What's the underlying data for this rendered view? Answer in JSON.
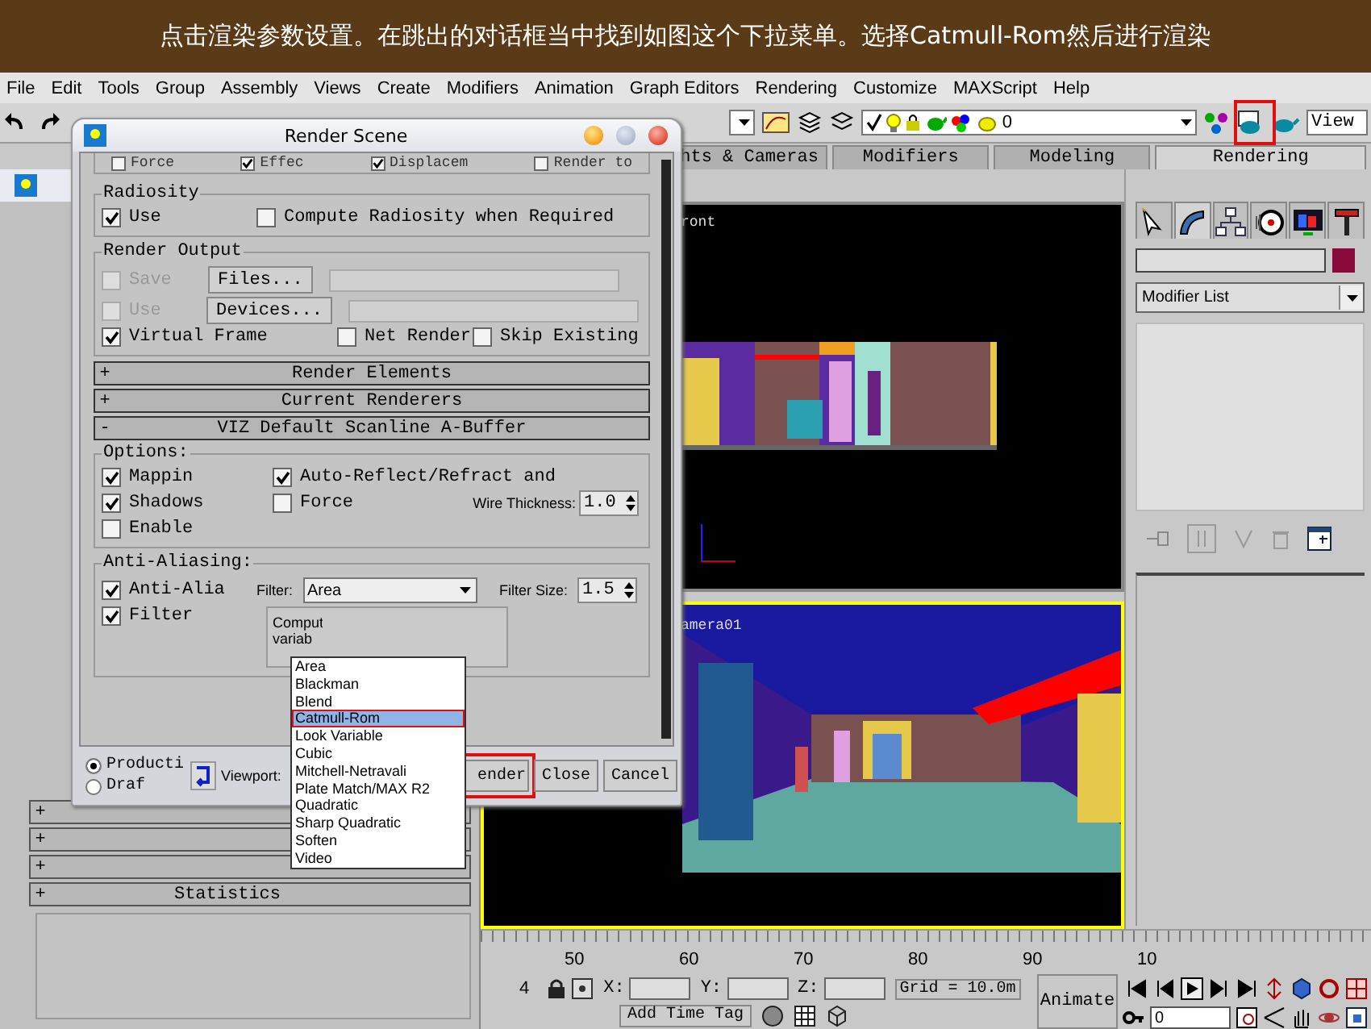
{
  "banner": {
    "text": "点击渲染参数设置。在跳出的对话框当中找到如图这个下拉菜单。选择Catmull-Rom然后进行渲染"
  },
  "menu": [
    "File",
    "Edit",
    "Tools",
    "Group",
    "Assembly",
    "Views",
    "Create",
    "Modifiers",
    "Animation",
    "Graph Editors",
    "Rendering",
    "Customize",
    "MAXScript",
    "Help"
  ],
  "toolbar": {
    "layer_value": "0",
    "view_field": "View"
  },
  "command_tabs": [
    {
      "label": "hts & Cameras",
      "selected": false
    },
    {
      "label": "Modifiers",
      "selected": false
    },
    {
      "label": "Modeling",
      "selected": false
    },
    {
      "label": "Rendering",
      "selected": true
    }
  ],
  "back_window": {
    "rollouts": [
      {
        "sign": "+"
      },
      {
        "sign": "+"
      },
      {
        "sign": "+"
      },
      {
        "sign": "+",
        "label": "Statistics"
      }
    ]
  },
  "viewports": [
    {
      "label": "ront",
      "active": false,
      "kind": "front"
    },
    {
      "label": "amera01",
      "active": true,
      "kind": "camera"
    }
  ],
  "command_panel": {
    "color": "#8b0a3c",
    "modifier_list": "Modifier List"
  },
  "timeline": {
    "ticks": [
      "50",
      "60",
      "70",
      "80",
      "90",
      "10"
    ]
  },
  "status": {
    "frame": "4",
    "x_label": "X:",
    "y_label": "Y:",
    "z_label": "Z:",
    "grid": "Grid = 10.0m",
    "add_time_tag": "Add Time Tag",
    "animate": "Animate",
    "frame_field": "0"
  },
  "dialog": {
    "title": "Render Scene",
    "top_row": [
      {
        "label": "Force",
        "checked": false,
        "disabled": false
      },
      {
        "label": "Effec",
        "checked": true,
        "disabled": false
      },
      {
        "label": "Displacem",
        "checked": true,
        "disabled": false
      },
      {
        "label": "Render to",
        "checked": false,
        "disabled": false
      }
    ],
    "radiosity": {
      "title": "Radiosity",
      "items": [
        {
          "label": "Use",
          "checked": true,
          "disabled": false
        },
        {
          "label": "Compute Radiosity when Required",
          "checked": false,
          "disabled": false
        }
      ]
    },
    "render_output": {
      "title": "Render Output",
      "rows": [
        {
          "label": "Save",
          "checked": false,
          "disabled": true,
          "button": "Files..."
        },
        {
          "label": "Use",
          "checked": false,
          "disabled": true,
          "button": "Devices..."
        }
      ],
      "flags": [
        {
          "label": "Virtual Frame",
          "checked": true,
          "disabled": false
        },
        {
          "label": "Net Render",
          "checked": false,
          "disabled": false
        },
        {
          "label": "Skip Existing",
          "checked": false,
          "disabled": false
        }
      ]
    },
    "rollouts": [
      {
        "sign": "+",
        "label": "Render Elements"
      },
      {
        "sign": "+",
        "label": "Current Renderers"
      },
      {
        "sign": "-",
        "label": "VIZ Default Scanline A-Buffer"
      }
    ],
    "options": {
      "title": "Options:",
      "items": [
        {
          "label": "Mappin",
          "checked": true,
          "disabled": false
        },
        {
          "label": "Auto-Reflect/Refract and",
          "checked": true,
          "disabled": false
        },
        {
          "label": "Shadows",
          "checked": true,
          "disabled": false
        },
        {
          "label": "Force",
          "checked": false,
          "disabled": false
        },
        {
          "label": "Enable",
          "checked": false,
          "disabled": false
        }
      ],
      "wire_label": "Wire Thickness:",
      "wire_value": "1.0"
    },
    "anti_aliasing": {
      "title": "Anti-Aliasing:",
      "items": [
        {
          "label": "Anti-Alia",
          "checked": true,
          "disabled": false
        },
        {
          "label": "Filter",
          "checked": true,
          "disabled": false
        }
      ],
      "filter_label": "Filter:",
      "filter_value": "Area",
      "size_label": "Filter Size:",
      "size_value": "1.5",
      "description": [
        "Comput",
        "variab"
      ]
    },
    "modes": [
      {
        "label": "Producti",
        "selected": true
      },
      {
        "label": "Draf",
        "selected": false
      }
    ],
    "viewport_label": "Viewport:",
    "buttons": [
      "ender",
      "Close",
      "Cancel"
    ]
  },
  "filter_dropdown": {
    "items": [
      {
        "label": "Area",
        "selected": false
      },
      {
        "label": "Blackman",
        "selected": false
      },
      {
        "label": "Blend",
        "selected": false
      },
      {
        "label": "Catmull-Rom",
        "selected": true
      },
      {
        "label": "Look Variable",
        "selected": false
      },
      {
        "label": "Cubic",
        "selected": false
      },
      {
        "label": "Mitchell-Netravali",
        "selected": false
      },
      {
        "label": "Plate Match/MAX R2",
        "selected": false
      },
      {
        "label": "Quadratic",
        "selected": false
      },
      {
        "label": "Sharp Quadratic",
        "selected": false
      },
      {
        "label": "Soften",
        "selected": false
      },
      {
        "label": "Video",
        "selected": false
      }
    ]
  }
}
